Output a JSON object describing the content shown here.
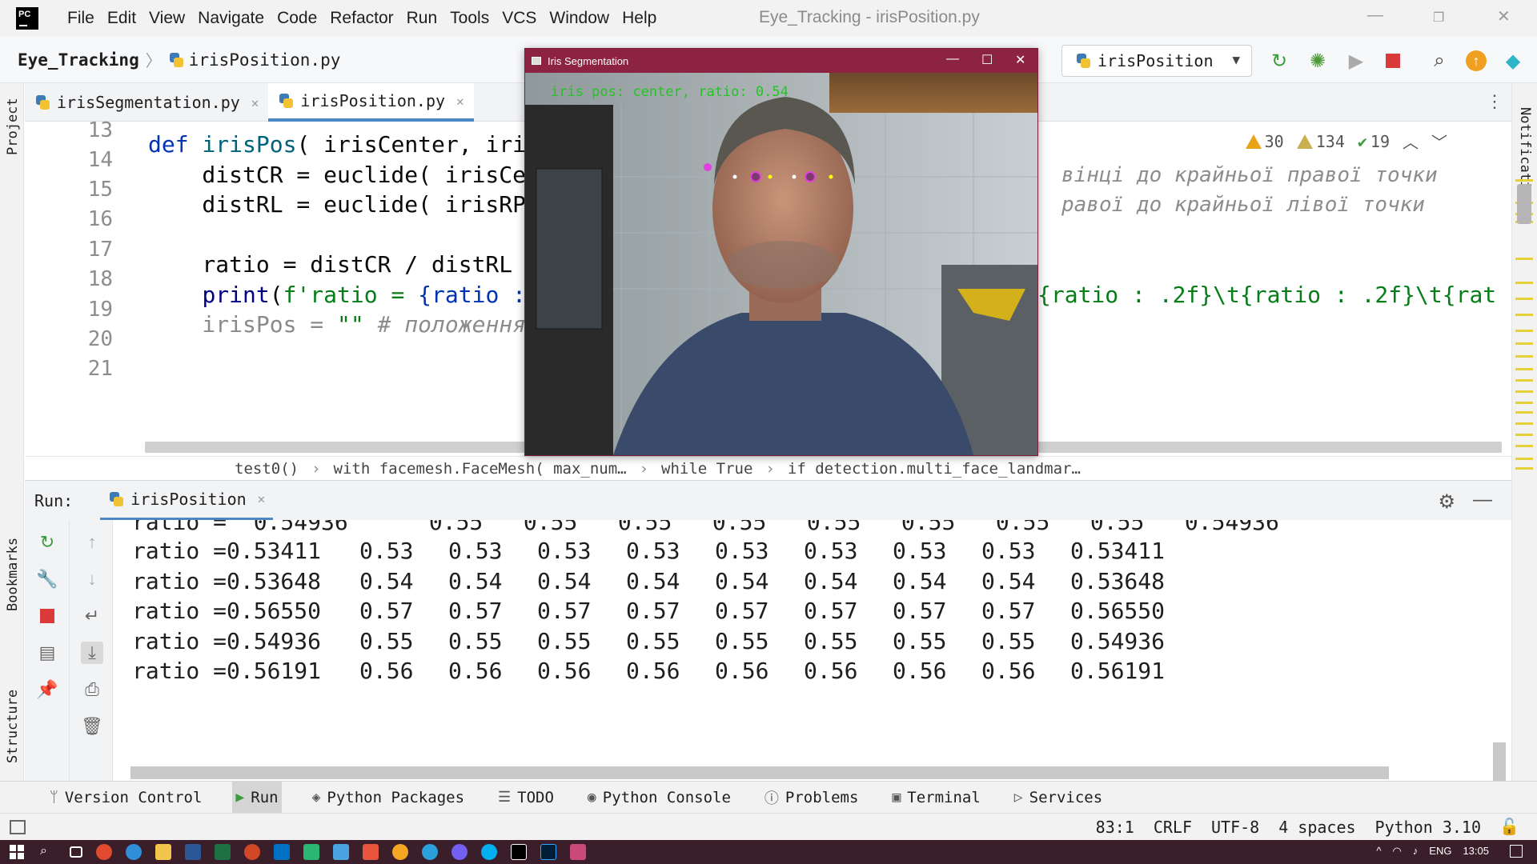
{
  "titlebar": {
    "logo_text": "PC",
    "menu": [
      "File",
      "Edit",
      "View",
      "Navigate",
      "Code",
      "Refactor",
      "Run",
      "Tools",
      "VCS",
      "Window",
      "Help"
    ],
    "window_title": "Eye_Tracking - irisPosition.py"
  },
  "navbar": {
    "project": "Eye_Tracking",
    "file": "irisPosition.py",
    "run_config": "irisPosition",
    "icons": [
      "rerun-icon",
      "debug-icon",
      "coverage-icon",
      "stop-icon",
      "search-icon",
      "update-icon",
      "jetbrains-icon"
    ]
  },
  "left_stripe": {
    "project": "Project",
    "bookmarks": "Bookmarks",
    "structure": "Structure"
  },
  "right_stripe": {
    "notifications": "Notifications"
  },
  "editor_tabs": [
    {
      "label": "irisSegmentation.py",
      "active": false
    },
    {
      "label": "irisPosition.py",
      "active": true
    }
  ],
  "inspections": {
    "warnings": "30",
    "weak_warnings": "134",
    "typos": "19"
  },
  "editor": {
    "line_numbers": [
      "13",
      "14",
      "15",
      "16",
      "17",
      "18",
      "19",
      "20",
      "21"
    ],
    "lines": {
      "l14_kw": "def ",
      "l14_fn": "irisPos",
      "l14_rest": "( irisCenter, iri",
      "l15": "    distCR = euclide( irisCe",
      "l15_cmt": "вінці до крайньої правої точки",
      "l16": "    distRL = euclide( irisRP",
      "l16_cmt": "равої до крайньої лівої точки",
      "l18": "    ratio = distCR / distRL",
      "l19_a": "    ",
      "l19_fn": "print",
      "l19_b": "(",
      "l19_str": "f'ratio = ",
      "l19_br": "{ratio :",
      "l19_right": "{ratio : .2f}\\t{ratio : .2f}\\t{rat",
      "l20_a": "    irisPos = ",
      "l20_str": "\"\"",
      "l20_cmt": " # положення"
    }
  },
  "breadcrumbs": [
    "test0()",
    "with facemesh.FaceMesh( max_num…",
    "while True",
    "if detection.multi_face_landmar…"
  ],
  "run_panel": {
    "label": "Run:",
    "tab": "irisPosition",
    "partial_row": "ratio =  0.54936      0.55   0.55   0.55   0.55   0.55   0.55   0.55   0.55   0.54936",
    "rows": [
      {
        "label": "ratio =",
        "raw": "0.53411",
        "vals": [
          "0.53",
          "0.53",
          "0.53",
          "0.53",
          "0.53",
          "0.53",
          "0.53",
          "0.53"
        ],
        "end": "0.53411"
      },
      {
        "label": "ratio =",
        "raw": "0.53648",
        "vals": [
          "0.54",
          "0.54",
          "0.54",
          "0.54",
          "0.54",
          "0.54",
          "0.54",
          "0.54"
        ],
        "end": "0.53648"
      },
      {
        "label": "ratio =",
        "raw": "0.56550",
        "vals": [
          "0.57",
          "0.57",
          "0.57",
          "0.57",
          "0.57",
          "0.57",
          "0.57",
          "0.57"
        ],
        "end": "0.56550"
      },
      {
        "label": "ratio =",
        "raw": "0.54936",
        "vals": [
          "0.55",
          "0.55",
          "0.55",
          "0.55",
          "0.55",
          "0.55",
          "0.55",
          "0.55"
        ],
        "end": "0.54936"
      },
      {
        "label": "ratio =",
        "raw": "0.56191",
        "vals": [
          "0.56",
          "0.56",
          "0.56",
          "0.56",
          "0.56",
          "0.56",
          "0.56",
          "0.56"
        ],
        "end": "0.56191"
      }
    ]
  },
  "bottom_tools": [
    {
      "label": "Version Control",
      "icon": "branch-icon",
      "active": false
    },
    {
      "label": "Run",
      "icon": "run-icon",
      "active": true
    },
    {
      "label": "Python Packages",
      "icon": "packages-icon",
      "active": false
    },
    {
      "label": "TODO",
      "icon": "todo-icon",
      "active": false
    },
    {
      "label": "Python Console",
      "icon": "python-console-icon",
      "active": false
    },
    {
      "label": "Problems",
      "icon": "problems-icon",
      "active": false
    },
    {
      "label": "Terminal",
      "icon": "terminal-icon",
      "active": false
    },
    {
      "label": "Services",
      "icon": "services-icon",
      "active": false
    }
  ],
  "statusbar": {
    "position": "83:1",
    "line_sep": "CRLF",
    "encoding": "UTF-8",
    "indent": "4 spaces",
    "interpreter": "Python 3.10"
  },
  "camera_window": {
    "title": "Iris Segmentation",
    "overlay_text": "iris pos: center, ratio: 0.54"
  },
  "taskbar": {
    "lang": "ENG",
    "time": "13:05"
  },
  "colors": {
    "accent": "#4a88c7",
    "camera_titlebar": "#8c2342",
    "taskbar": "#3a1f2a",
    "keyword": "#0033b3",
    "string": "#067d17"
  }
}
